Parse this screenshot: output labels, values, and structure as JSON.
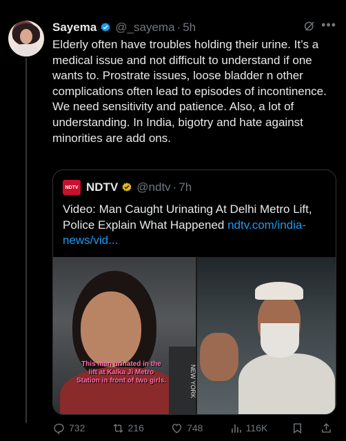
{
  "post": {
    "name": "Sayema",
    "handle": "@_sayema",
    "separator": "·",
    "time": "5h",
    "more_icon": "more-icon",
    "text": "Elderly often have troubles holding their urine. It’s a medical issue and not difficult to understand if one wants to. Prostrate issues, loose bladder n other complications often lead to episodes of incontinence.\nWe need sensitivity and patience. Also, a lot of understanding. In India, bigotry and hate against minorities are add ons."
  },
  "quote": {
    "logo_text": "NDTV",
    "name": "NDTV",
    "handle": "@ndtv",
    "separator": "·",
    "time": "7h",
    "text_plain": "Video: Man Caught Urinating At Delhi Metro Lift, Police Explain What Happened ",
    "text_link": "ndtv.com/india-news/vid...",
    "media_caption": "This man urinated in the lift at Kalka Ji Metro Station in front of two girls.",
    "tee_text": "NEW YORK"
  },
  "actions": {
    "replies": "732",
    "reposts": "216",
    "likes": "748",
    "views": "116K"
  },
  "colors": {
    "background": "#000000",
    "text": "#e7e9ea",
    "muted": "#71767b",
    "link": "#1d9bf0",
    "verified_blue": "#1d9bf0",
    "verified_gold": "#e2b719"
  }
}
